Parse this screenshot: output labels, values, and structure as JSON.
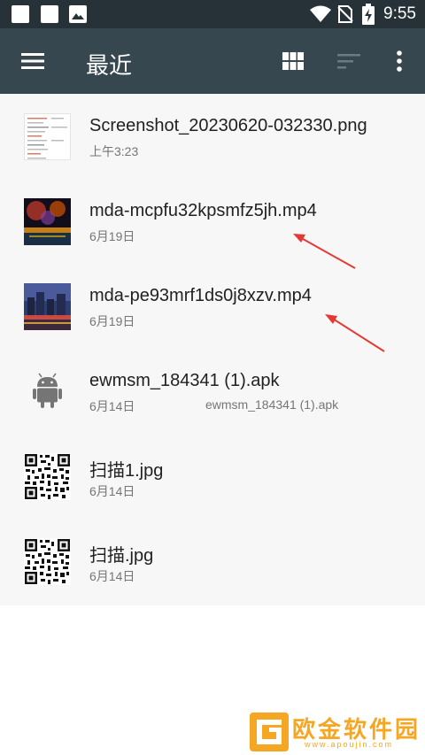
{
  "statusbar": {
    "time": "9:55",
    "icons": [
      "notification-icon",
      "notification-icon",
      "image-icon",
      "wifi-icon",
      "no-sim-icon",
      "battery-charging-icon"
    ]
  },
  "toolbar": {
    "title": "最近",
    "menu_icon": "menu-icon",
    "grid_icon": "grid-view-icon",
    "sort_icon": "sort-icon",
    "more_icon": "more-vert-icon"
  },
  "files": [
    {
      "name": "Screenshot_20230620-032330.png",
      "date": "上午3:23",
      "extra": "",
      "thumb": "document-screenshot"
    },
    {
      "name": "mda-mcpfu32kpsmfz5jh.mp4",
      "date": "6月19日",
      "extra": "",
      "thumb": "fireworks-video"
    },
    {
      "name": "mda-pe93mrf1ds0j8xzv.mp4",
      "date": "6月19日",
      "extra": "",
      "thumb": "city-night-video"
    },
    {
      "name": "ewmsm_184341 (1).apk",
      "date": "6月14日",
      "extra": "ewmsm_184341 (1).apk",
      "thumb": "android-icon"
    },
    {
      "name": "扫描1.jpg",
      "date": "6月14日",
      "extra": "",
      "thumb": "qr-code"
    },
    {
      "name": "扫描.jpg",
      "date": "6月14日",
      "extra": "",
      "thumb": "qr-code"
    }
  ],
  "colors": {
    "toolbar": "#37474f",
    "statusbar": "#263238",
    "annotation_arrow": "#e53935",
    "watermark": "#f5a623"
  },
  "watermark": {
    "text": "欧金软件园",
    "url": "www.apoujin.com"
  }
}
